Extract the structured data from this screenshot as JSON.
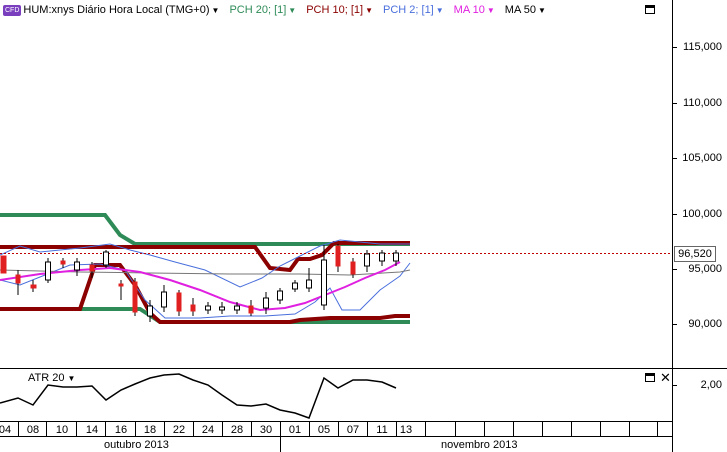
{
  "legend": {
    "badge": "CFD",
    "symbol": "HUM:xnys Diário Hora Local (TMG+0)",
    "items": [
      {
        "label": "PCH 20; [1]",
        "color": "#2e8b57"
      },
      {
        "label": "PCH 10; [1]",
        "color": "#8b0000"
      },
      {
        "label": "PCH 2; [1]",
        "color": "#4a6fdc"
      },
      {
        "label": "MA 10",
        "color": "#e020e0"
      },
      {
        "label": "MA 50",
        "color": "#000000"
      }
    ]
  },
  "price_axis": {
    "labels": [
      "115,000",
      "110,000",
      "105,000",
      "100,000",
      "95,000",
      "90,000"
    ],
    "current_price": "96,520"
  },
  "indicator": {
    "label": "ATR 20",
    "axis_label": "2,00"
  },
  "time_axis": {
    "ticks": [
      "04",
      "08",
      "10",
      "14",
      "16",
      "18",
      "22",
      "24",
      "28",
      "30",
      "01",
      "05",
      "07",
      "11",
      "13"
    ],
    "months": [
      "outubro 2013",
      "novembro 2013"
    ]
  },
  "colors": {
    "pch20": "#2e8b57",
    "pch10": "#8b0000",
    "pch2": "#4a6fdc",
    "ma10": "#e020e0",
    "ma50": "#555555",
    "up_candle": "#000000",
    "down_candle": "#e02020",
    "current_price_line": "#c00000"
  }
}
